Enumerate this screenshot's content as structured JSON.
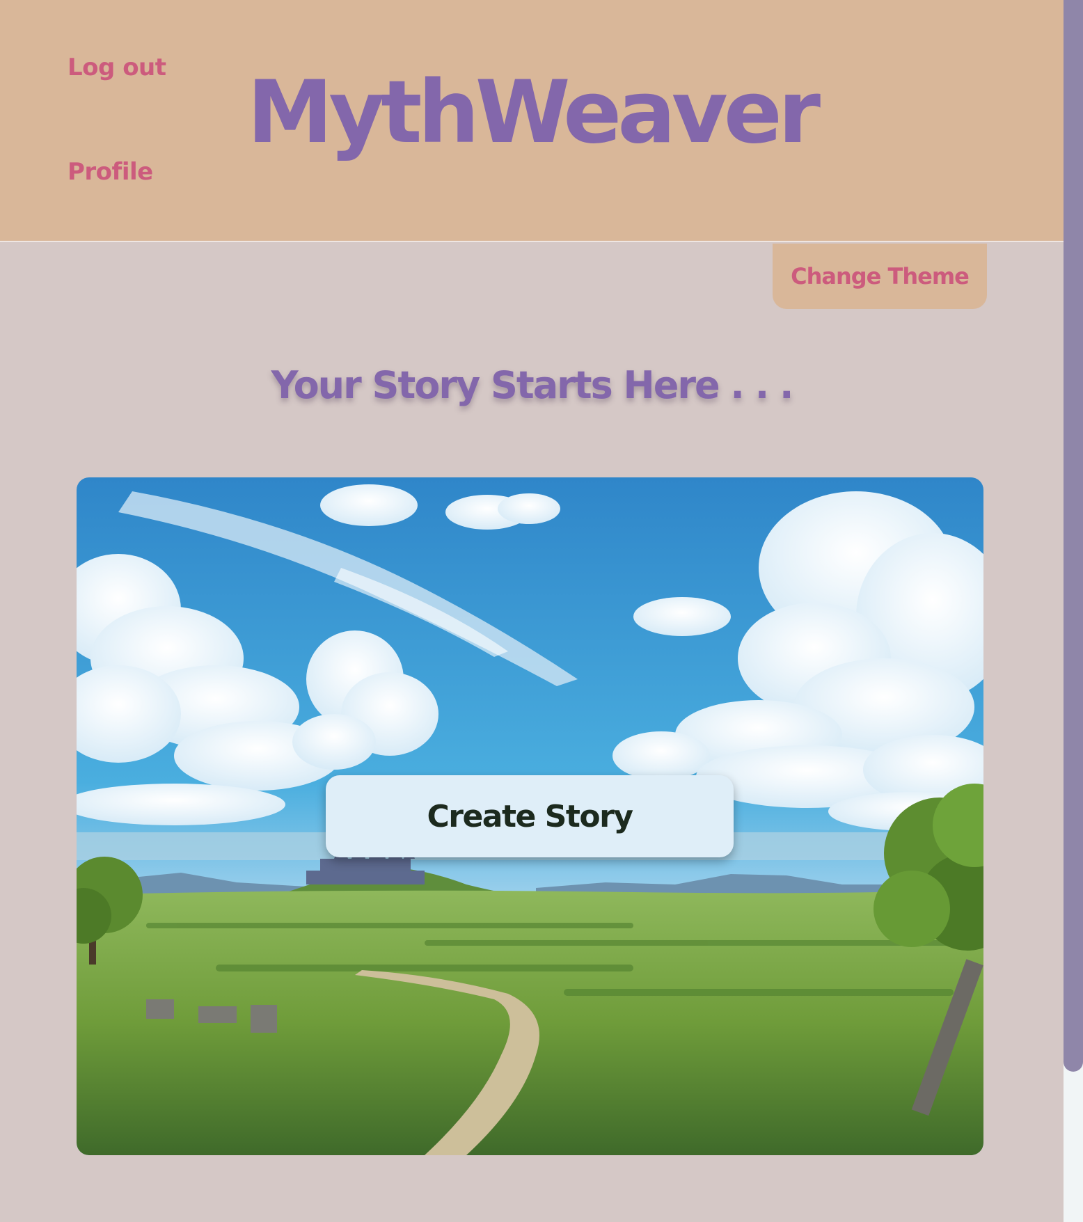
{
  "header": {
    "brand": "MythWeaver",
    "nav": {
      "logout": "Log out",
      "profile": "Profile"
    }
  },
  "theme": {
    "button_label": "Change Theme"
  },
  "main": {
    "heading": "Your Story Starts Here . . .",
    "hero_image": "fantasy-landscape-castle",
    "create_button": "Create Story"
  },
  "colors": {
    "header_bg": "#d9b799",
    "page_bg": "#d5c8c6",
    "link": "#cc5b7d",
    "brand": "#8367ab",
    "button_bg": "#dfeef8",
    "scroll_thumb": "#8f86a9"
  }
}
